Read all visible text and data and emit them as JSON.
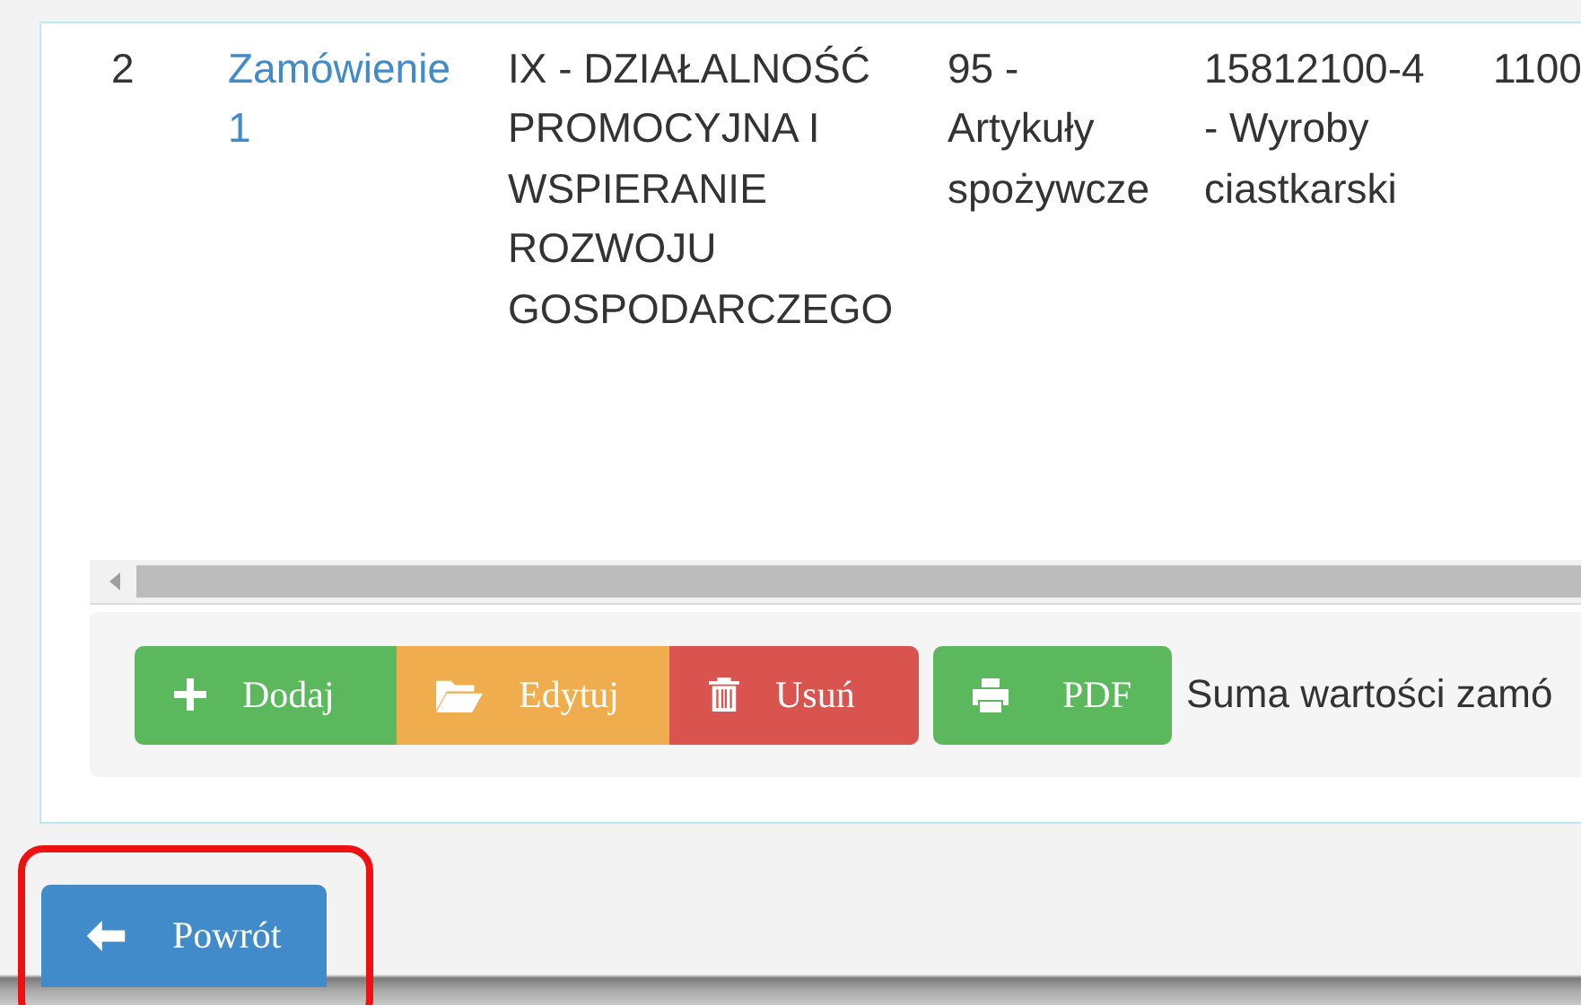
{
  "table": {
    "rows": [
      {
        "cells": [
          {
            "kind": "text",
            "text": "2"
          },
          {
            "kind": "link",
            "text": "Zamówienie 1"
          },
          {
            "kind": "text",
            "text": "IX - DZIAŁALNOŚĆ PROMOCYJNA I WSPIERANIE ROZWOJU GOSPODARCZEGO"
          },
          {
            "kind": "text",
            "text": "95 - Artykuły spożywcze"
          },
          {
            "kind": "text",
            "text": "15812100-4 - Wyroby ciastkarski"
          },
          {
            "kind": "text",
            "text": "1100"
          }
        ]
      }
    ]
  },
  "toolbar": {
    "buttons": [
      {
        "kind": "add",
        "label": "Dodaj"
      },
      {
        "kind": "edit",
        "label": "Edytuj"
      },
      {
        "kind": "delete",
        "label": "Usuń"
      },
      {
        "kind": "pdf",
        "label": "PDF"
      }
    ],
    "summary": "Suma wartości zamó"
  },
  "back_button": {
    "label": "Powrót"
  }
}
